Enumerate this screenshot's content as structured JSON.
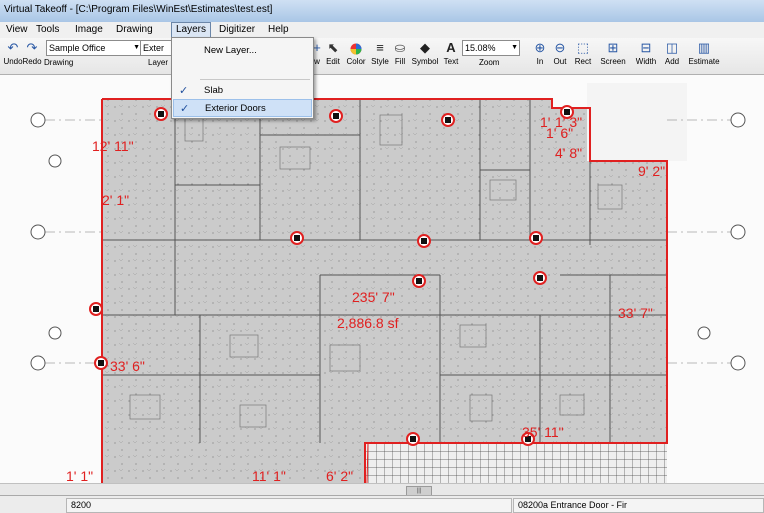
{
  "window": {
    "title": "Virtual Takeoff - [C:\\Program Files\\WinEst\\Estimates\\test.est]"
  },
  "menu": [
    "View",
    "Tools",
    "Image",
    "Drawing",
    "Layers",
    "Digitizer",
    "Help"
  ],
  "toolbar": {
    "undo": "Undo",
    "redo": "Redo",
    "drawing_label": "Drawing",
    "drawing_value": "Sample Office",
    "layer_label": "Layer",
    "layer_value": "Exter",
    "new_view": "w",
    "edit": "Edit",
    "color": "Color",
    "style": "Style",
    "fill": "Fill",
    "symbol": "Symbol",
    "text": "Text",
    "zoom_label": "Zoom",
    "zoom_value": "15.08%",
    "zoom_in": "In",
    "zoom_out": "Out",
    "rect": "Rect",
    "screen": "Screen",
    "width": "Width",
    "add": "Add",
    "estimate": "Estimate"
  },
  "layers_menu": {
    "new_layer": "New Layer...",
    "items": [
      {
        "label": "Slab",
        "checked": true
      },
      {
        "label": "Exterior Doors",
        "checked": true
      }
    ]
  },
  "measurements": {
    "m1": "12' 11\"",
    "m2": "2' 1\"",
    "m3": "1'",
    "m4": "1' 3\"",
    "m5": "1' 6\"",
    "m6": "4' 8\"",
    "m7": "9' 2\"",
    "perimeter": "235' 7\"",
    "area": "2,886.8 sf",
    "m8": "33' 7\"",
    "m9": "33' 6\"",
    "m10": "35' 11\"",
    "m11": "1' 1\"",
    "m12": "11' 1\"",
    "m13": "6' 2\""
  },
  "colors": {
    "takeoff_outline": "#e02020",
    "menu_highlight": "#cfe1f7"
  },
  "statusbar": {
    "left": "8200",
    "right": "08200a  Entrance Door - Fir"
  }
}
